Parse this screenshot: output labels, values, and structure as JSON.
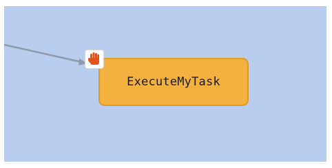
{
  "diagram": {
    "node": {
      "label": "ExecuteMyTask",
      "type_icon": "hand-icon"
    },
    "colors": {
      "canvas": "#b9cdee",
      "node_fill": "#f3b13f",
      "node_border": "#e09a26",
      "edge": "#8f9aaa",
      "icon": "#e2541c"
    }
  }
}
